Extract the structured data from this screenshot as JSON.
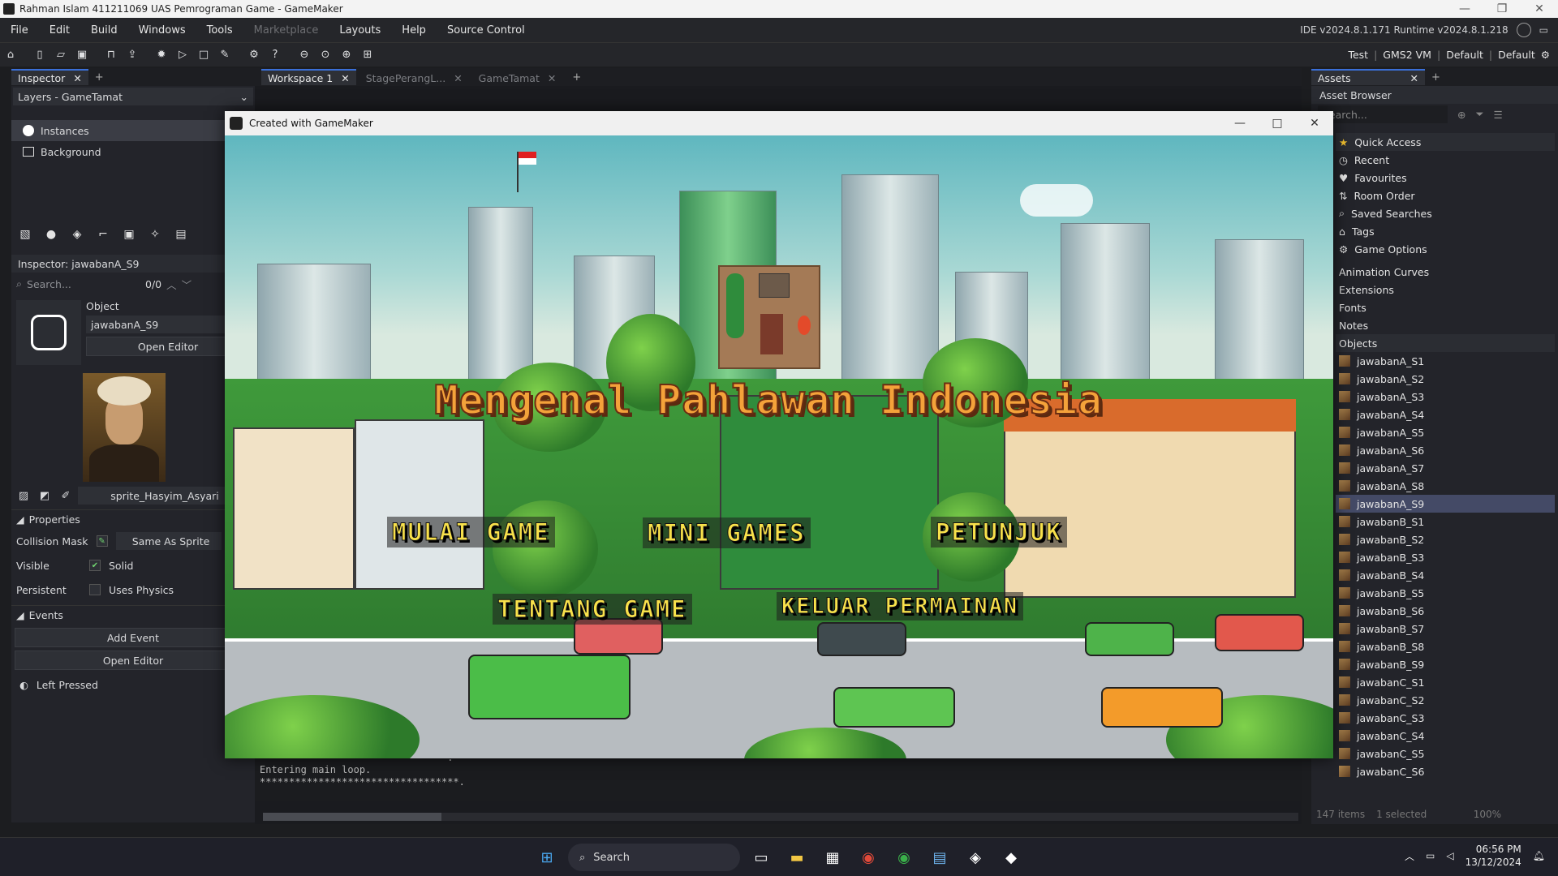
{
  "window": {
    "title": "Rahman Islam 411211069 UAS Pemrograman Game - GameMaker"
  },
  "menu": {
    "items": [
      "File",
      "Edit",
      "Build",
      "Windows",
      "Tools",
      "Marketplace",
      "Layouts",
      "Help",
      "Source Control"
    ],
    "version": "IDE v2024.8.1.171  Runtime v2024.8.1.218"
  },
  "target": {
    "items": [
      "Test",
      "GMS2 VM",
      "Default",
      "Default"
    ]
  },
  "inspector": {
    "tab": "Inspector",
    "layers_title": "Layers - GameTamat",
    "layers": [
      "Instances",
      "Background"
    ],
    "title": "Inspector: jawabanA_S9",
    "search_placeholder": "Search...",
    "match_count": "0/0",
    "object_label": "Object",
    "object_name": "jawabanA_S9",
    "open_editor": "Open Editor",
    "sprite_name": "sprite_Hasyim_Asyari",
    "properties": "Properties",
    "collision_mask": "Collision Mask",
    "collision_value": "Same As Sprite",
    "visible": "Visible",
    "solid": "Solid",
    "persistent": "Persistent",
    "uses_physics": "Uses Physics",
    "events": "Events",
    "add_event": "Add Event",
    "open_editor2": "Open Editor",
    "event_left_pressed": "Left Pressed"
  },
  "workspace": {
    "tabs": [
      "Workspace 1",
      "StagePerangL...",
      "GameTamat"
    ]
  },
  "console": {
    "lines": [
      "********************************.",
      "Entering main loop.",
      "**********************************."
    ]
  },
  "game": {
    "window_title": "Created with GameMaker",
    "title": "Mengenal Pahlawan Indonesia",
    "buttons": {
      "start": "MULAI GAME",
      "mini": "MINI GAMES",
      "help": "PETUNJUK",
      "about": "TENTANG GAME",
      "quit": "KELUAR PERMAINAN"
    }
  },
  "assets": {
    "tab": "Assets",
    "browser": "Asset Browser",
    "search_placeholder": "Search...",
    "quick": [
      "Quick Access",
      "Recent",
      "Favourites",
      "Room Order",
      "Saved Searches",
      "Tags",
      "Game Options"
    ],
    "groups": [
      "Animation Curves",
      "Extensions",
      "Fonts",
      "Notes",
      "Objects"
    ],
    "objects": [
      "jawabanA_S1",
      "jawabanA_S2",
      "jawabanA_S3",
      "jawabanA_S4",
      "jawabanA_S5",
      "jawabanA_S6",
      "jawabanA_S7",
      "jawabanA_S8",
      "jawabanA_S9",
      "jawabanB_S1",
      "jawabanB_S2",
      "jawabanB_S3",
      "jawabanB_S4",
      "jawabanB_S5",
      "jawabanB_S6",
      "jawabanB_S7",
      "jawabanB_S8",
      "jawabanB_S9",
      "jawabanC_S1",
      "jawabanC_S2",
      "jawabanC_S3",
      "jawabanC_S4",
      "jawabanC_S5",
      "jawabanC_S6"
    ],
    "selected": "jawabanA_S9",
    "count": "147 items",
    "selected_count": "1 selected",
    "zoom": "100%"
  },
  "taskbar": {
    "search": "Search",
    "time": "06:56 PM",
    "date": "13/12/2024"
  }
}
